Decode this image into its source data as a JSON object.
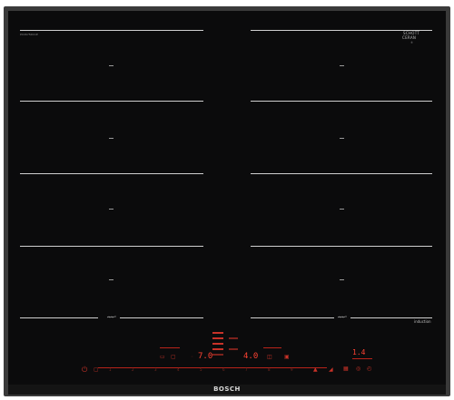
{
  "appliance": {
    "brand": "BOSCH",
    "glass_brand_line1": "SCHOTT",
    "glass_brand_line2": "CERAN",
    "glass_brand_small": "®",
    "model_small": "PXX675DC1E",
    "mode_label": "induction"
  },
  "display": {
    "left_level": "7.0",
    "center_level": "4.0",
    "timer": "1.4"
  },
  "slider": {
    "numbers": [
      "1",
      "2",
      "3",
      "4",
      "5",
      "6",
      "7",
      "8",
      "9"
    ]
  },
  "icons": {
    "power": "power-icon",
    "lock": "lock-icon",
    "pan": "pan-icon",
    "timer": "timer-icon"
  },
  "colors": {
    "glass": "#0b0b0c",
    "frame": "#3a3a3a",
    "zone_line": "#cfcfcf",
    "accent_red": "#e03a2e"
  }
}
